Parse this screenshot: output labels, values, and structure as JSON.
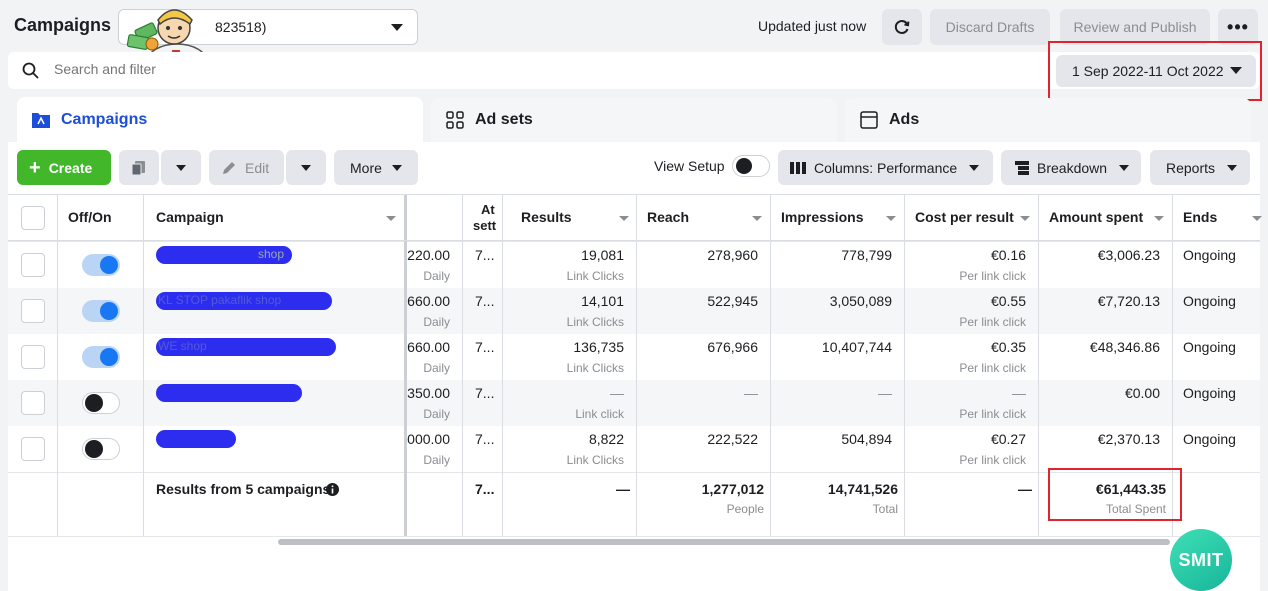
{
  "topbar": {
    "title": "Campaigns",
    "account_value": "823518)",
    "updated": "Updated just now",
    "discard": "Discard Drafts",
    "review": "Review and Publish",
    "more": "•••"
  },
  "search": {
    "placeholder": "Search and filter",
    "date_range": "1 Sep 2022-11 Oct 2022"
  },
  "tabs": [
    {
      "label": "Campaigns"
    },
    {
      "label": "Ad sets"
    },
    {
      "label": "Ads"
    }
  ],
  "toolbar": {
    "create": "Create",
    "edit": "Edit",
    "more": "More",
    "view_setup": "View Setup",
    "columns": "Columns: Performance",
    "breakdown": "Breakdown",
    "reports": "Reports"
  },
  "table": {
    "headers": {
      "onoff": "Off/On",
      "campaign": "Campaign",
      "attr_1": "At",
      "attr_2": "sett",
      "results": "Results",
      "reach": "Reach",
      "impressions": "Impressions",
      "cpr": "Cost per result",
      "spent": "Amount spent",
      "ends": "Ends"
    },
    "rows": [
      {
        "on": true,
        "name_hint": "shop",
        "budget": "220.00",
        "budget_type": "Daily",
        "attr": "7...",
        "results": "19,081",
        "results_sub": "Link Clicks",
        "reach": "278,960",
        "impressions": "778,799",
        "cpr": "€0.16",
        "cpr_sub": "Per link click",
        "spent": "€3,006.23",
        "ends": "Ongoing"
      },
      {
        "on": true,
        "name_hint": "KL     STOP pakaflik shop",
        "budget": "660.00",
        "budget_type": "Daily",
        "attr": "7...",
        "results": "14,101",
        "results_sub": "Link Clicks",
        "reach": "522,945",
        "impressions": "3,050,089",
        "cpr": "€0.55",
        "cpr_sub": "Per link click",
        "spent": "€7,720.13",
        "ends": "Ongoing"
      },
      {
        "on": true,
        "name_hint": "WE                shop",
        "budget": "660.00",
        "budget_type": "Daily",
        "attr": "7...",
        "results": "136,735",
        "results_sub": "Link Clicks",
        "reach": "676,966",
        "impressions": "10,407,744",
        "cpr": "€0.35",
        "cpr_sub": "Per link click",
        "spent": "€48,346.86",
        "ends": "Ongoing"
      },
      {
        "on": false,
        "name_hint": "",
        "budget": "350.00",
        "budget_type": "Daily",
        "attr": "7...",
        "results": "—",
        "results_sub": "Link click",
        "reach": "—",
        "impressions": "—",
        "cpr": "—",
        "cpr_sub": "Per link click",
        "spent": "€0.00",
        "ends": "Ongoing"
      },
      {
        "on": false,
        "name_hint": "",
        "budget": "000.00",
        "budget_type": "Daily",
        "attr": "7...",
        "results": "8,822",
        "results_sub": "Link Clicks",
        "reach": "222,522",
        "impressions": "504,894",
        "cpr": "€0.27",
        "cpr_sub": "Per link click",
        "spent": "€2,370.13",
        "ends": "Ongoing"
      }
    ],
    "summary": {
      "label": "Results from 5 campaigns",
      "attr": "7...",
      "results": "—",
      "reach": "1,277,012",
      "reach_sub": "People",
      "impressions": "14,741,526",
      "impressions_sub": "Total",
      "cpr": "—",
      "spent": "€61,443.35",
      "spent_sub": "Total Spent"
    }
  },
  "badge": {
    "text": "SMIT"
  },
  "colors": {
    "accent": "#1877f2",
    "create": "#42b72a",
    "highlight": "#e0232c",
    "redaction": "#2222ee"
  }
}
